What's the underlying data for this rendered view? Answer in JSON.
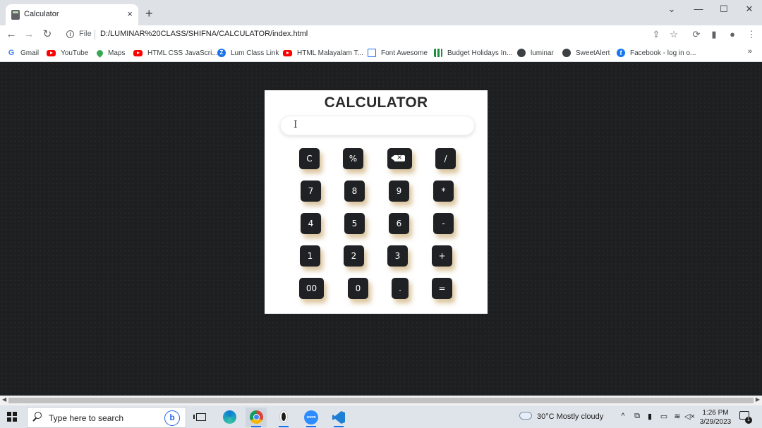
{
  "browser": {
    "tab": {
      "title": "Calculator",
      "close_icon": "×"
    },
    "new_tab_icon": "+",
    "window_controls": {
      "dropdown": "⌄",
      "minimize": "—",
      "maximize": "☐",
      "close": "✕"
    },
    "nav": {
      "back": "←",
      "forward": "→",
      "reload": "↻"
    },
    "omnibox": {
      "scheme": "File",
      "url": "D:/LUMINAR%20CLASS/SHIFNA/CALCULATOR/index.html",
      "info_icon": "i"
    },
    "toolbar_icons": {
      "share": "⇪",
      "star": "☆",
      "extensions": "⟳",
      "side_panel": "▮",
      "profile": "●",
      "menu": "⋮"
    },
    "bookmarks": [
      {
        "label": "Gmail",
        "icon": "gmail-icon"
      },
      {
        "label": "YouTube",
        "icon": "youtube-icon"
      },
      {
        "label": "Maps",
        "icon": "maps-icon"
      },
      {
        "label": "HTML CSS JavaScri...",
        "icon": "youtube-icon"
      },
      {
        "label": "Lum Class Link",
        "icon": "zoom-icon"
      },
      {
        "label": "HTML Malayalam T...",
        "icon": "youtube-icon"
      },
      {
        "label": "Font Awesome",
        "icon": "flag-icon"
      },
      {
        "label": "Budget Holidays In...",
        "icon": "chart-icon"
      },
      {
        "label": "luminar",
        "icon": "globe-icon"
      },
      {
        "label": "SweetAlert",
        "icon": "globe-icon"
      },
      {
        "label": "Facebook - log in o...",
        "icon": "facebook-icon"
      }
    ],
    "bookmarks_more": "»"
  },
  "calculator": {
    "title": "CALCULATOR",
    "display_value": "",
    "cursor_glyph": "I",
    "keys": [
      [
        "C",
        "%",
        "",
        "/"
      ],
      [
        "7",
        "8",
        "9",
        "*"
      ],
      [
        "4",
        "5",
        "6",
        "-"
      ],
      [
        "1",
        "2",
        "3",
        "+"
      ],
      [
        "00",
        "0",
        ".",
        "="
      ]
    ]
  },
  "taskbar": {
    "search_placeholder": "Type here to search",
    "bing_label": "b",
    "zoom_label": "zoom",
    "weather": "30°C  Mostly cloudy",
    "tray": {
      "chevron": "^",
      "mic": "🎤",
      "network": "≋",
      "volume": "🔈"
    },
    "time": "1:26 PM",
    "date": "3/29/2023",
    "notifications_count": "1"
  }
}
